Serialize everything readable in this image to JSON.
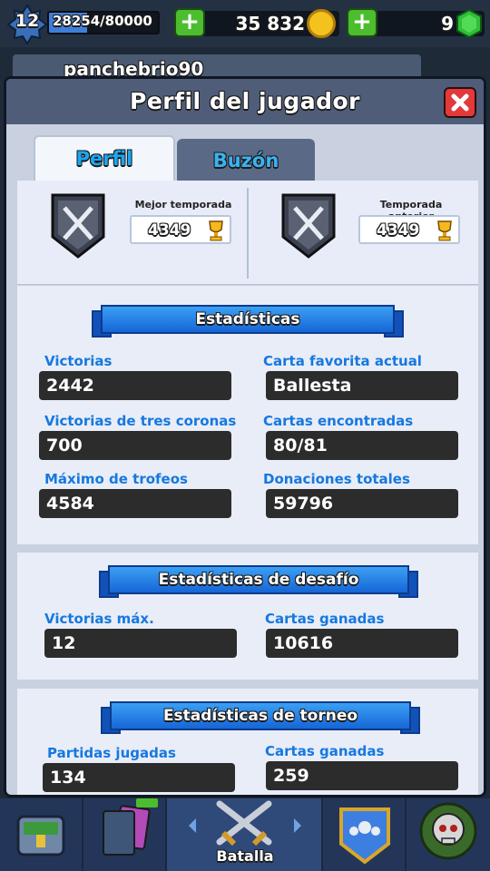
{
  "top": {
    "level": "12",
    "xp": "28254/80000",
    "xp_fraction": 0.353,
    "gold": "35 832",
    "gems": "9"
  },
  "behind": {
    "player_name": "panchebrio90"
  },
  "modal": {
    "title": "Perfil del jugador",
    "tabs": [
      {
        "label": "Perfil",
        "active": true
      },
      {
        "label": "Buzón",
        "active": false
      }
    ],
    "best_season": {
      "label": "Mejor temporada",
      "trophies": "4349"
    },
    "previous_season": {
      "label": "Temporada anterior",
      "trophies": "4349"
    },
    "stats": {
      "title": "Estadísticas",
      "items": [
        {
          "label": "Victorias",
          "value": "2442"
        },
        {
          "label": "Carta favorita actual",
          "value": "Ballesta"
        },
        {
          "label": "Victorias de tres coronas",
          "value": "700"
        },
        {
          "label": "Cartas encontradas",
          "value": "80/81"
        },
        {
          "label": "Máximo de trofeos",
          "value": "4584"
        },
        {
          "label": "Donaciones totales",
          "value": "59796"
        }
      ]
    },
    "challenge": {
      "title": "Estadísticas de desafío",
      "items": [
        {
          "label": "Victorias máx.",
          "value": "12"
        },
        {
          "label": "Cartas ganadas",
          "value": "10616"
        }
      ]
    },
    "tournament": {
      "title": "Estadísticas de torneo",
      "items": [
        {
          "label": "Partidas jugadas",
          "value": "134"
        },
        {
          "label": "Cartas ganadas",
          "value": "259"
        }
      ]
    }
  },
  "bottom_nav": {
    "active_label": "Batalla",
    "tabs": [
      "shop-chest-icon",
      "cards-icon",
      "battle-swords-icon",
      "clan-icon",
      "tournament-skull-icon"
    ]
  },
  "colors": {
    "label_blue": "#1678e0",
    "tab_blue": "#1aa7f0",
    "ribbon_blue": "#2a86e8",
    "close_red": "#e2393a",
    "gold": "#f3c21e",
    "gem_green": "#2fbf3a"
  }
}
